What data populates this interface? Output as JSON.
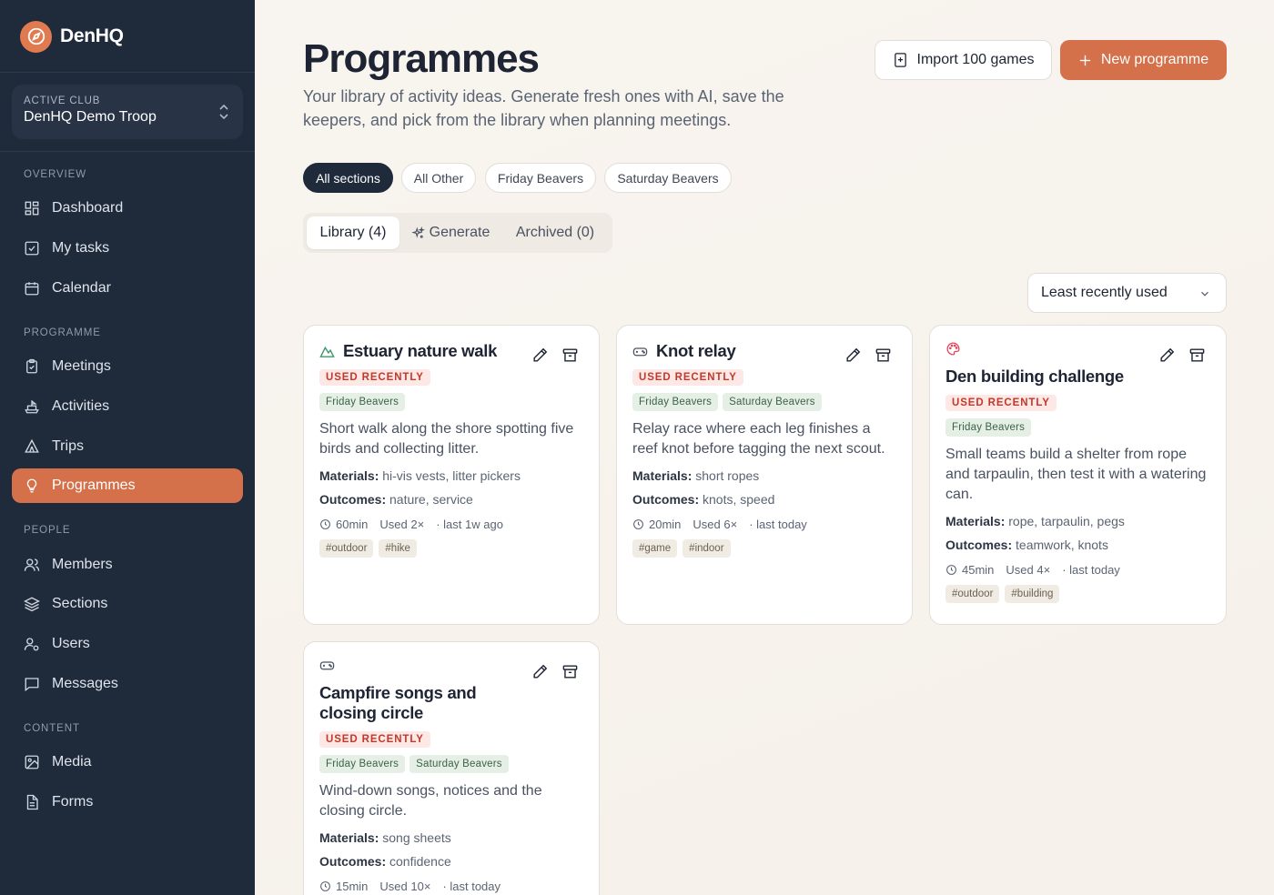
{
  "brand": {
    "name": "DenHQ"
  },
  "club": {
    "label": "ACTIVE CLUB",
    "name": "DenHQ Demo Troop"
  },
  "sidebar": {
    "sections": {
      "overview": "OVERVIEW",
      "programme": "PROGRAMME",
      "people": "PEOPLE",
      "content": "CONTENT"
    },
    "items": [
      {
        "label": "Dashboard",
        "icon": "dashboard-icon"
      },
      {
        "label": "My tasks",
        "icon": "task-check-icon"
      },
      {
        "label": "Calendar",
        "icon": "calendar-icon"
      },
      {
        "label": "Meetings",
        "icon": "clipboard-icon"
      },
      {
        "label": "Activities",
        "icon": "ship-icon"
      },
      {
        "label": "Trips",
        "icon": "tent-icon"
      },
      {
        "label": "Programmes",
        "icon": "lightbulb-icon",
        "active": true
      },
      {
        "label": "Members",
        "icon": "members-icon"
      },
      {
        "label": "Sections",
        "icon": "layers-icon"
      },
      {
        "label": "Users",
        "icon": "user-cog-icon"
      },
      {
        "label": "Messages",
        "icon": "message-icon"
      },
      {
        "label": "Media",
        "icon": "image-icon"
      },
      {
        "label": "Forms",
        "icon": "file-icon"
      }
    ]
  },
  "header": {
    "title": "Programmes",
    "subtitle": "Your library of activity ideas. Generate fresh ones with AI, save the keepers, and pick from the library when planning meetings.",
    "import_label": "Import 100 games",
    "new_label": "New programme"
  },
  "filters": [
    "All sections",
    "All Other",
    "Friday Beavers",
    "Saturday Beavers"
  ],
  "tabs": {
    "library": "Library (4)",
    "generate": "Generate",
    "archived": "Archived (0)"
  },
  "sort": {
    "value": "Least recently used"
  },
  "labels": {
    "used_recently": "USED RECENTLY",
    "materials": "Materials:",
    "outcomes": "Outcomes:"
  },
  "cards": [
    {
      "title": "Estuary nature walk",
      "icon": "mountain-icon",
      "sections": [
        "Friday Beavers"
      ],
      "description": "Short walk along the shore spotting five birds and collecting litter.",
      "materials": "hi-vis vests, litter pickers",
      "outcomes": "nature, service",
      "duration": "60min",
      "used": "Used 2×",
      "last": "· last 1w ago",
      "tags": [
        "#outdoor",
        "#hike"
      ]
    },
    {
      "title": "Knot relay",
      "icon": "gamepad-icon",
      "sections": [
        "Friday Beavers",
        "Saturday Beavers"
      ],
      "description": "Relay race where each leg finishes a reef knot before tagging the next scout.",
      "materials": "short ropes",
      "outcomes": "knots, speed",
      "duration": "20min",
      "used": "Used 6×",
      "last": "· last today",
      "tags": [
        "#game",
        "#indoor"
      ]
    },
    {
      "title": "Den building challenge",
      "icon": "palette-icon",
      "sections": [
        "Friday Beavers"
      ],
      "description": "Small teams build a shelter from rope and tarpaulin, then test it with a watering can.",
      "materials": "rope, tarpaulin, pegs",
      "outcomes": "teamwork, knots",
      "duration": "45min",
      "used": "Used 4×",
      "last": "· last today",
      "tags": [
        "#outdoor",
        "#building"
      ]
    },
    {
      "title": "Campfire songs and closing circle",
      "icon": "gamepad-icon",
      "sections": [
        "Friday Beavers",
        "Saturday Beavers"
      ],
      "description": "Wind-down songs, notices and the closing circle.",
      "materials": "song sheets",
      "outcomes": "confidence",
      "duration": "15min",
      "used": "Used 10×",
      "last": "· last today",
      "tags": []
    }
  ],
  "colors": {
    "sidebar_bg": "#1f2a3a",
    "accent": "#d4704a",
    "used_recently": "#c0392b",
    "section_tag": "#3a6346",
    "page_bg": "#f7f3ee"
  }
}
